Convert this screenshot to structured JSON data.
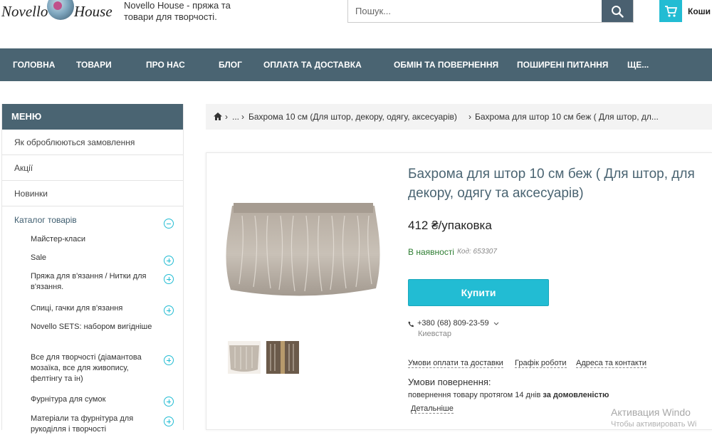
{
  "brand": {
    "logo_word1": "Novello",
    "logo_word2": "House",
    "tagline": "Novello House - пряжа та товари для творчості."
  },
  "search": {
    "placeholder": "Пошук..."
  },
  "cart": {
    "label": "Коши"
  },
  "nav": [
    "ГОЛОВНА",
    "ТОВАРИ",
    "ПРО НАС",
    "БЛОГ",
    "ОПЛАТА ТА ДОСТАВКА",
    "ОБМІН ТА ПОВЕРНЕННЯ",
    "ПОШИРЕНІ ПИТАННЯ",
    "ЩЕ..."
  ],
  "sidebar": {
    "heading": "МЕНЮ",
    "items": [
      "Як оброблюються замовлення",
      "Акції",
      "Новинки"
    ],
    "catalog_title": "Каталог товарів",
    "subitems": [
      "Майстер-класи",
      "Sale",
      "Пряжа для в'язання / Нитки для в'язання.",
      "Спиці, гачки для в'язання",
      "Novello SETS: набором вигідніше",
      "Все для творчості (діамантова мозаїка, все для живопису, фелтінгу та ін)",
      "Фурнітура для сумок",
      "Матеріали та фурнітура для рукоділля і творчості"
    ]
  },
  "breadcrumb": {
    "sep": "›",
    "ellipsis": "...",
    "category": "Бахрома 10 см (Для штор, декору, одягу, аксесуарів)",
    "current": "Бахрома для штор 10 см беж ( Для штор, дл..."
  },
  "product": {
    "title": "Бахрома для штор 10 см беж ( Для штор, для декору, одягу та аксесуарів)",
    "price": "412 ₴/упаковка",
    "availability": "В наявності",
    "sku": "Код: 653307",
    "buy_label": "Купити",
    "phone": "+380 (68) 809-23-59",
    "operator": "Киевстар",
    "links": [
      "Умови оплати та доставки",
      "Графік роботи",
      "Адреса та контакти"
    ],
    "returns_title": "Умови повернення:",
    "returns_text": "повернення товару протягом 14 днів",
    "returns_bold": "за домовленістю",
    "more_label": "Детальніше"
  },
  "watermark": {
    "line1": "Активация Windo",
    "line2": "Чтобы активировать Wi"
  },
  "colors": {
    "nav_bg": "#4a6472",
    "accent": "#22bcd3",
    "in_stock": "#2e7d32"
  }
}
